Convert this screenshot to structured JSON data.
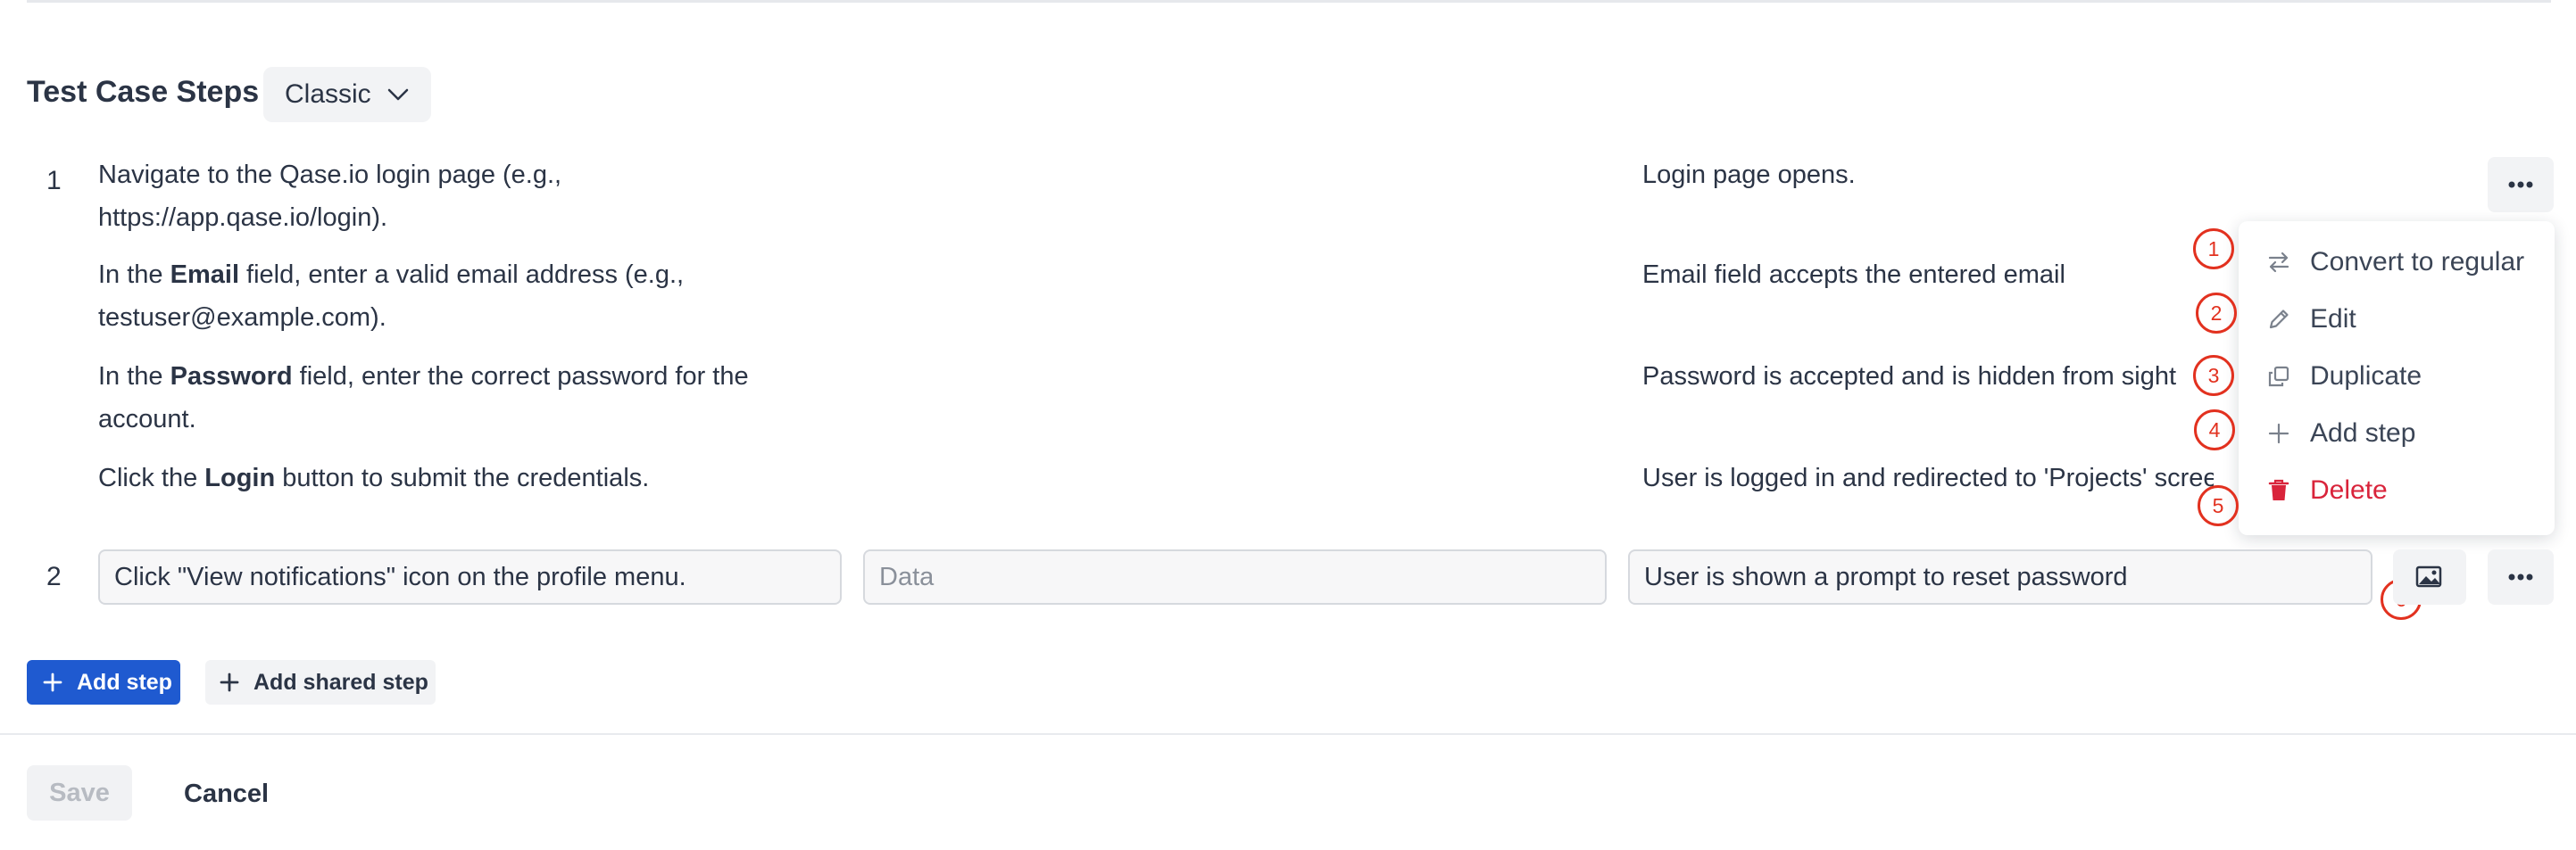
{
  "section": {
    "title": "Test Case Steps",
    "view_mode": "Classic"
  },
  "steps": [
    {
      "number": "1",
      "substeps": [
        {
          "action": [
            {
              "text": "Navigate to the Qase.io login page (e.g.,",
              "bold": false
            },
            {
              "text": "https://app.qase.io/login).",
              "bold": false
            }
          ],
          "expected": "Login page opens."
        },
        {
          "action": [
            {
              "text": "In the ",
              "bold": false
            },
            {
              "text": "Email",
              "bold": true
            },
            {
              "text": " field, enter a valid email address (e.g.,",
              "bold": false
            },
            {
              "text": "testuser@example.com).",
              "bold": false
            }
          ],
          "expected": "Email field accepts the entered email"
        },
        {
          "action": [
            {
              "text": "In the ",
              "bold": false
            },
            {
              "text": "Password",
              "bold": true
            },
            {
              "text": " field, enter the correct password for the",
              "bold": false
            },
            {
              "text": "account.",
              "bold": false
            }
          ],
          "expected": "Password is accepted and is hidden from sight"
        },
        {
          "action": [
            {
              "text": "Click the ",
              "bold": false
            },
            {
              "text": "Login",
              "bold": true
            },
            {
              "text": " button to submit the credentials.",
              "bold": false
            }
          ],
          "expected": "User is logged in and redirected to 'Projects' scree"
        }
      ]
    },
    {
      "number": "2",
      "action_value": "Click \"View notifications\" icon on the profile menu.",
      "data_placeholder": "Data",
      "expected_value": "User is shown a prompt to reset password"
    }
  ],
  "context_menu": {
    "items": [
      {
        "label": "Convert to regular",
        "icon": "convert-icon"
      },
      {
        "label": "Edit",
        "icon": "pencil-icon"
      },
      {
        "label": "Duplicate",
        "icon": "duplicate-icon"
      },
      {
        "label": "Add step",
        "icon": "plus-icon"
      },
      {
        "label": "Delete",
        "icon": "trash-icon"
      }
    ]
  },
  "callouts": [
    "1",
    "2",
    "3",
    "4",
    "5",
    "6"
  ],
  "buttons": {
    "add_step": "Add step",
    "add_shared_step": "Add shared step",
    "save": "Save",
    "cancel": "Cancel"
  },
  "colors": {
    "primary": "#1f5ad0",
    "danger": "#d9243b",
    "callout": "#e2311f"
  }
}
